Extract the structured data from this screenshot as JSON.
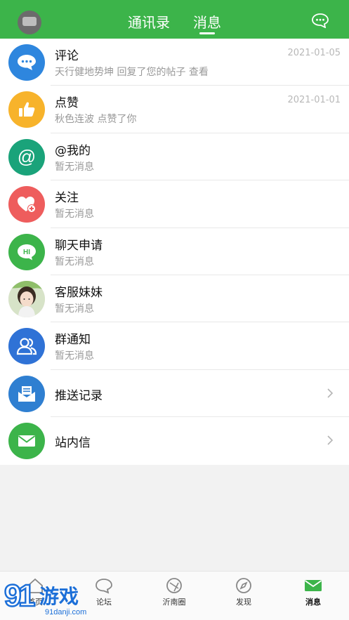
{
  "header": {
    "tabs": [
      {
        "label": "通讯录"
      },
      {
        "label": "消息"
      }
    ]
  },
  "messages": [
    {
      "title": "评论",
      "subtitle": "天行健地势坤 回复了您的帖子   查看",
      "date": "2021-01-05",
      "icon": "comment-icon",
      "color": "#2e86de"
    },
    {
      "title": "点赞",
      "subtitle": "秋色连波 点赞了你",
      "date": "2021-01-01",
      "icon": "thumbs-up-icon",
      "color": "#f7b32b"
    },
    {
      "title": "@我的",
      "subtitle": "暂无消息",
      "icon": "at-icon",
      "color": "#1aa37a"
    },
    {
      "title": "关注",
      "subtitle": "暂无消息",
      "icon": "heart-plus-icon",
      "color": "#ee5d5d"
    },
    {
      "title": "聊天申请",
      "subtitle": "暂无消息",
      "icon": "hi-bubble-icon",
      "color": "#3cb44a"
    },
    {
      "title": "客服妹妹",
      "subtitle": "暂无消息",
      "icon": "avatar",
      "color": "#dcdcdc"
    },
    {
      "title": "群通知",
      "subtitle": "暂无消息",
      "icon": "group-icon",
      "color": "#2f72d6"
    },
    {
      "title": "推送记录",
      "icon": "envelope-open-icon",
      "color": "#2f7fd1"
    },
    {
      "title": "站内信",
      "icon": "mail-icon",
      "color": "#3cb44a"
    }
  ],
  "tabbar": [
    {
      "label": "首页",
      "icon": "home-icon"
    },
    {
      "label": "论坛",
      "icon": "forum-icon"
    },
    {
      "label": "沂南圈",
      "icon": "circle-icon"
    },
    {
      "label": "发现",
      "icon": "compass-icon"
    },
    {
      "label": "消息",
      "icon": "mail-icon"
    }
  ],
  "watermark": {
    "logo_number": "9",
    "logo_text": "游戏",
    "url": "91danji.com"
  },
  "colors": {
    "brand_green": "#3cb44a"
  }
}
